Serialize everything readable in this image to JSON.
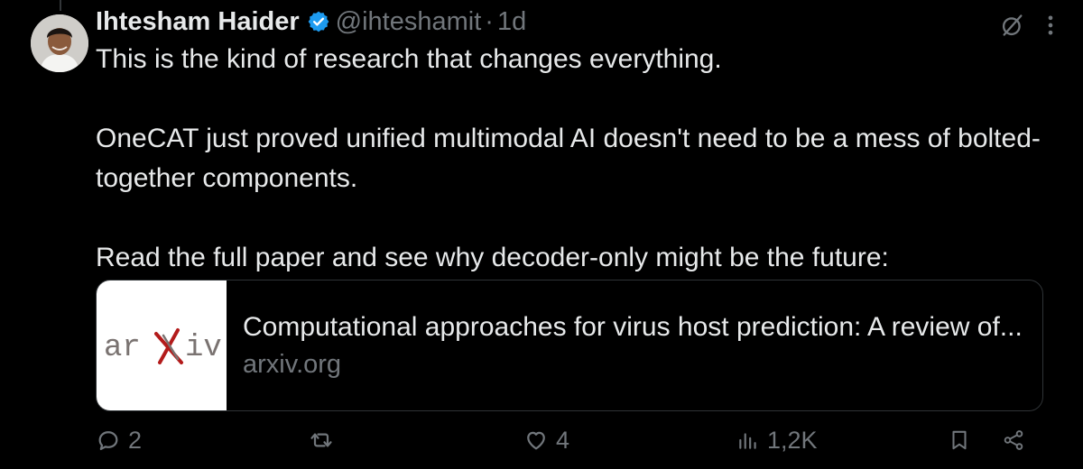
{
  "author": {
    "name": "Ihtesham Haider",
    "handle": "@ihteshamit",
    "separator": "·",
    "time": "1d"
  },
  "tweet": {
    "paragraphs": [
      "This is the kind of research that changes everything.",
      "OneCAT just proved unified multimodal AI doesn't need to be a mess of bolted-together components.",
      "Read the full paper and see why decoder-only might be the future:"
    ]
  },
  "card": {
    "logo_text": "arXiv",
    "title": "Computational approaches for virus host prediction: A review of...",
    "domain": "arxiv.org"
  },
  "actions": {
    "replies": "2",
    "reposts": "",
    "likes": "4",
    "views": "1,2K"
  },
  "icons": {
    "verified": "verified-badge-icon",
    "grok": "grok-icon",
    "more": "more-icon",
    "reply": "reply-icon",
    "repost": "repost-icon",
    "like": "like-icon",
    "views": "views-icon",
    "bookmark": "bookmark-icon",
    "share": "share-icon"
  },
  "colors": {
    "background": "#000000",
    "text": "#e7e9ea",
    "muted": "#71767b",
    "verified": "#1d9bf0",
    "arxiv_red": "#b31b1b"
  }
}
